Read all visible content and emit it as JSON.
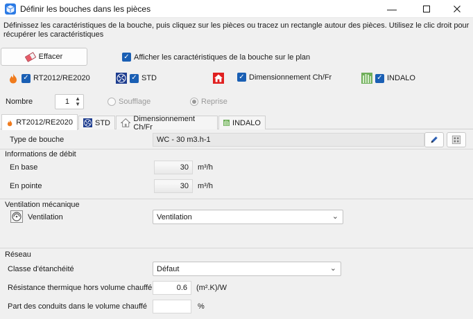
{
  "window": {
    "title": "Définir les bouches dans les pièces"
  },
  "instructions": "Définissez les caractéristiques de la bouche, puis cliquez sur les pièces ou tracez un rectangle autour des pièces. Utilisez le clic droit pour récupérer les caractéristiques",
  "toolbar": {
    "clear_label": "Effacer",
    "show_on_plan_label": "Afficher les caractéristiques de la bouche sur le plan"
  },
  "modules": [
    {
      "label": "RT2012/RE2020",
      "icon": "flame-icon",
      "checked": true
    },
    {
      "label": "STD",
      "icon": "fan-icon",
      "checked": true
    },
    {
      "label": "Dimensionnement Ch/Fr",
      "icon": "house-icon",
      "checked": true
    },
    {
      "label": "INDALO",
      "icon": "indalo-icon",
      "checked": true
    }
  ],
  "count": {
    "label": "Nombre",
    "value": "1"
  },
  "flow_mode": {
    "options": [
      {
        "label": "Soufflage",
        "selected": false
      },
      {
        "label": "Reprise",
        "selected": true
      }
    ]
  },
  "tabs": [
    {
      "label": "RT2012/RE2020",
      "active": true
    },
    {
      "label": "STD",
      "active": false
    },
    {
      "label": "Dimensionnement Ch/Fr",
      "active": false
    },
    {
      "label": "INDALO",
      "active": false
    }
  ],
  "form": {
    "vent_type": {
      "label": "Type de bouche",
      "value": "WC - 30 m3.h-1"
    },
    "flow_section": "Informations de débit",
    "base": {
      "label": "En base",
      "value": "30",
      "unit": "m³/h"
    },
    "peak": {
      "label": "En pointe",
      "value": "30",
      "unit": "m³/h"
    },
    "mech_section": "Ventilation mécanique",
    "ventilation": {
      "label": "Ventilation",
      "value": "Ventilation"
    },
    "network_section": "Réseau",
    "tightness": {
      "label": "Classe d'étanchéité",
      "value": "Défaut"
    },
    "thermal_res": {
      "label": "Résistance thermique hors volume chauffé",
      "value": "0.6",
      "unit": "(m².K)/W"
    },
    "ducts_share": {
      "label": "Part des conduits dans le volume chauffé",
      "value": "",
      "unit": "%"
    }
  },
  "colors": {
    "accent": "#1a5fb4",
    "flame": "#f07b1d",
    "std": "#1e3d8f",
    "house": "#e02020",
    "indalo": "#6fae5a"
  }
}
